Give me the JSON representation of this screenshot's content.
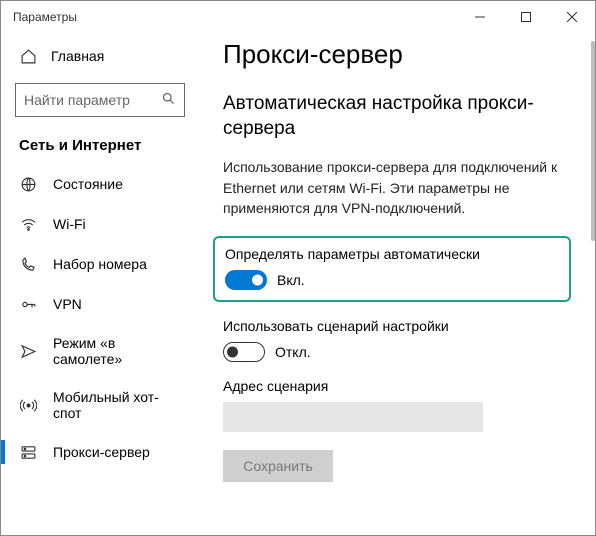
{
  "window": {
    "title": "Параметры"
  },
  "sidebar": {
    "home": "Главная",
    "search_placeholder": "Найти параметр",
    "section": "Сеть и Интернет",
    "items": [
      {
        "label": "Состояние"
      },
      {
        "label": "Wi-Fi"
      },
      {
        "label": "Набор номера"
      },
      {
        "label": "VPN"
      },
      {
        "label": "Режим «в самолете»"
      },
      {
        "label": "Мобильный хот-спот"
      },
      {
        "label": "Прокси-сервер"
      }
    ]
  },
  "main": {
    "title": "Прокси-сервер",
    "subtitle": "Автоматическая настройка прокси-сервера",
    "description": "Использование прокси-сервера для подключений к Ethernet или сетям Wi-Fi. Эти параметры не применяются для VPN-подключений.",
    "auto_detect": {
      "label": "Определять параметры автоматически",
      "state": "Вкл."
    },
    "use_script": {
      "label": "Использовать сценарий настройки",
      "state": "Откл."
    },
    "script_address_label": "Адрес сценария",
    "save": "Сохранить"
  }
}
